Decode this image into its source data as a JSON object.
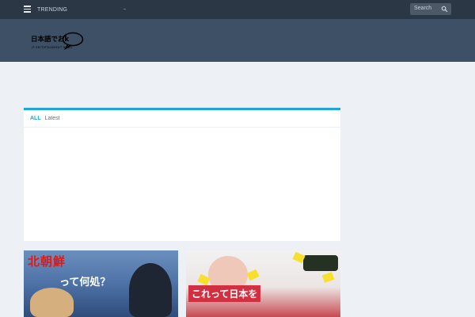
{
  "topbar": {
    "trending_label": "TRENDING",
    "search_placeholder": "Search"
  },
  "logo": {
    "name": "日本語でおk",
    "subtitle": "JP ENTERTAINMENT NEWS"
  },
  "panel": {
    "tab_all": "ALL",
    "tab_latest": "Latest"
  },
  "thumbnails": [
    {
      "title_red": "北朝鮮",
      "title_white": "って何処？"
    },
    {
      "title_overlay": "これって日本を"
    }
  ],
  "colors": {
    "topbar": "#2b3744",
    "header": "#3e5066",
    "accent": "#1fa3e3",
    "page_bg": "#edf1f5"
  }
}
